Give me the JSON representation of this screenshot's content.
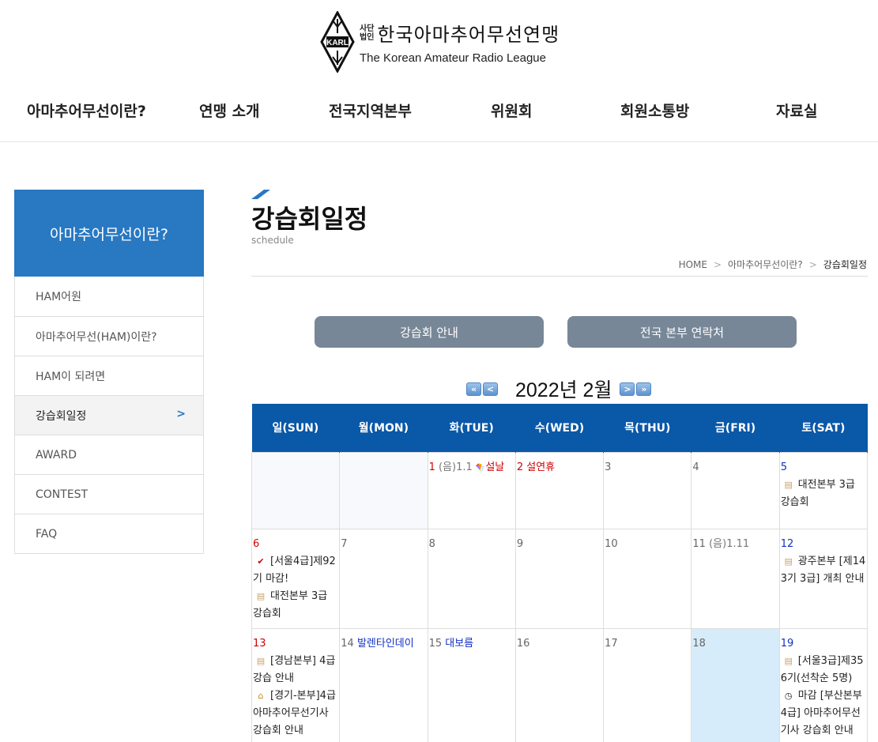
{
  "logo": {
    "emblem_text": "KARL",
    "small_top": "사단",
    "small_bottom": "법인",
    "name_ko": "한국아마추어무선연맹",
    "name_en": "The Korean Amateur Radio League"
  },
  "gnb": [
    "아마추어무선이란?",
    "연맹 소개",
    "전국지역본부",
    "위원회",
    "회원소통방",
    "자료실"
  ],
  "sidebar": {
    "title": "아마추어무선이란?",
    "items": [
      {
        "label": "HAM어원"
      },
      {
        "label": "아마추어무선(HAM)이란?"
      },
      {
        "label": "HAM이 되려면"
      },
      {
        "label": "강습회일정",
        "active": true,
        "arrow": ">"
      },
      {
        "label": "AWARD"
      },
      {
        "label": "CONTEST"
      },
      {
        "label": "FAQ"
      }
    ]
  },
  "page": {
    "title": "강습회일정",
    "subtitle": "schedule",
    "breadcrumb": [
      "HOME",
      "아마추어무선이란?",
      "강습회일정"
    ],
    "breadcrumb_sep": ">"
  },
  "buttons": {
    "guide": "강습회 안내",
    "contacts": "전국 본부 연락처"
  },
  "calendar": {
    "title": "2022년 2월",
    "nav": {
      "prev_year": "«",
      "prev_month": "<",
      "next_month": ">",
      "next_year": "»"
    },
    "weekdays": [
      "일(SUN)",
      "월(MON)",
      "화(TUE)",
      "수(WED)",
      "목(THU)",
      "금(FRI)",
      "토(SAT)"
    ],
    "week1": {
      "tue_day": "1",
      "tue_lunar": " (음)1.1 ",
      "tue_holiday": "설날",
      "wed_day": "2",
      "wed_holiday": " 설연휴",
      "thu_day": "3",
      "fri_day": "4",
      "sat_day": "5",
      "sat_ev1": "대전본부 3급 강습회"
    },
    "week2": {
      "sun_day": "6",
      "sun_ev1": "[서울4급]제92기 마감!",
      "sun_ev2": "대전본부 3급 강습회",
      "mon_day": "7",
      "tue_day": "8",
      "wed_day": "9",
      "thu_day": "10",
      "fri_day": "11",
      "fri_lunar": " (음)1.11",
      "sat_day": "12",
      "sat_ev1": "광주본부 [제143기 3급] 개최 안내"
    },
    "week3": {
      "sun_day": "13",
      "sun_ev1": "[경남본부] 4급강습 안내",
      "sun_ev2": "[경기-본부]4급 아마추어무선기사 강습회 안내",
      "mon_day": "14",
      "mon_holiday": " 발렌타인데이",
      "tue_day": "15",
      "tue_holiday": " 대보름",
      "wed_day": "16",
      "thu_day": "17",
      "fri_day": "18",
      "sat_day": "19",
      "sat_ev1": "[서울3급]제356기(선착순 5명)",
      "sat_ev2": "마감 [부산본부4급] 아마추어무선기사 강습회 안내"
    }
  },
  "colors": {
    "primary": "#2878c2",
    "header_blue": "#0a58a8",
    "button_gray": "#778797",
    "today_bg": "#d7ecfa"
  }
}
